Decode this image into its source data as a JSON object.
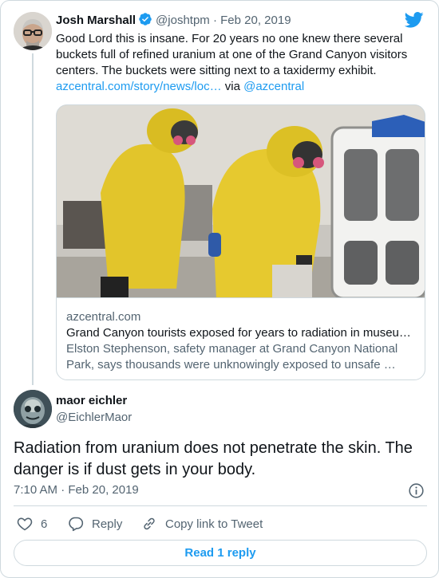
{
  "colors": {
    "accent": "#1d9bf0",
    "text": "#0f1419",
    "muted": "#536471",
    "border": "#cfd9de"
  },
  "icons": {
    "logo": "twitter-bird-icon",
    "verified": "verified-badge-icon",
    "like": "heart-icon",
    "reply": "speech-bubble-icon",
    "copy_link": "chain-link-icon",
    "info": "info-circle-icon"
  },
  "parent_tweet": {
    "author_name": "Josh Marshall",
    "handle": "@joshtpm",
    "separator": "·",
    "date": "Feb 20, 2019",
    "text": "Good Lord this is insane. For 20 years no one knew there several buckets full of refined uranium at one of the Grand Canyon visitors centers. The buckets were sitting next to a taxidermy exhibit.",
    "link_text": "azcentral.com/story/news/loc…",
    "via": "via",
    "mention": "@azcentral",
    "card": {
      "image_description": "two workers in yellow hazmat suits and respirators",
      "domain": "azcentral.com",
      "title": "Grand Canyon tourists exposed for years to radiation in museu…",
      "description": "Elston Stephenson, safety manager at Grand Canyon National Park, says thousands were unknowingly exposed to unsafe …"
    }
  },
  "reply_tweet": {
    "author_name": "maor eichler",
    "handle": "@EichlerMaor",
    "text": "Radiation from uranium does not penetrate the skin. The danger is if dust gets in your body.",
    "timestamp": "7:10 AM · Feb 20, 2019",
    "likes": "6",
    "reply_label": "Reply",
    "copy_link_label": "Copy link to Tweet",
    "read_replies_label": "Read 1 reply"
  }
}
